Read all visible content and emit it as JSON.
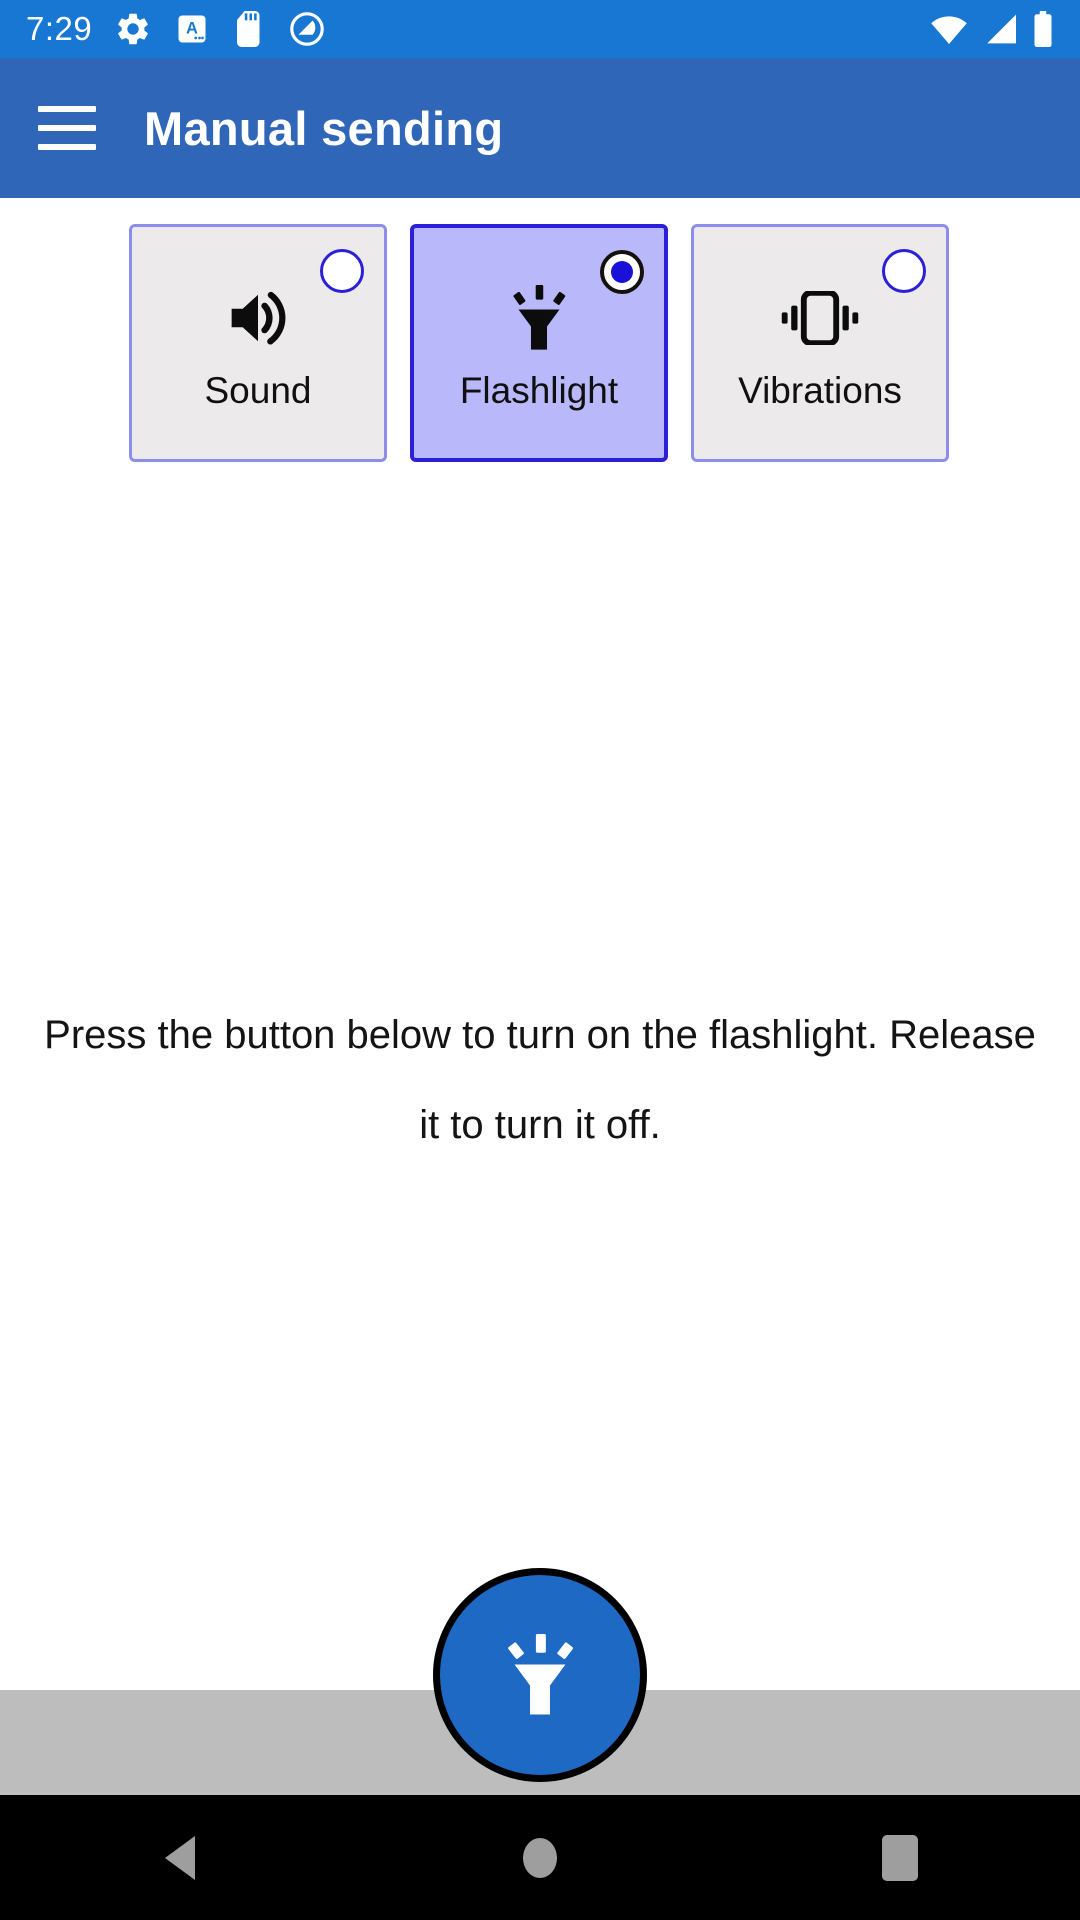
{
  "status_bar": {
    "clock": "7:29",
    "left_icons": [
      "gear-icon",
      "auto-rotate-a-icon",
      "sd-card-icon",
      "do-not-disturb-icon"
    ],
    "right_icons": [
      "wifi-icon",
      "cellular-signal-icon",
      "battery-icon"
    ],
    "background_color": "#1877D2"
  },
  "app_bar": {
    "menu_label": "hamburger-menu",
    "title": "Manual sending",
    "background_color": "#3066B8"
  },
  "modes": {
    "selected": "Flashlight",
    "items": [
      {
        "label": "Sound",
        "icon": "volume-up-icon",
        "selected": false
      },
      {
        "label": "Flashlight",
        "icon": "flashlight-icon",
        "selected": true
      },
      {
        "label": "Vibrations",
        "icon": "vibration-icon",
        "selected": false
      }
    ],
    "card_background": "#ECEAEA",
    "card_border": "#8D8DEB",
    "selected_background": "#B8B8FA",
    "selected_border": "#2B20D8"
  },
  "main": {
    "instruction": "Press the button below to turn on the flashlight. Release it to turn it off."
  },
  "fab": {
    "icon": "flashlight-icon",
    "background_color": "#1D69C4",
    "focus_ring_color": "#000000"
  },
  "nav_bar": {
    "items": [
      {
        "label": "Back",
        "icon": "back-triangle-icon"
      },
      {
        "label": "Home",
        "icon": "home-circle-icon"
      },
      {
        "label": "Recents",
        "icon": "recents-square-icon"
      }
    ],
    "background_color": "#000000",
    "icon_color": "#9E9E9E"
  }
}
